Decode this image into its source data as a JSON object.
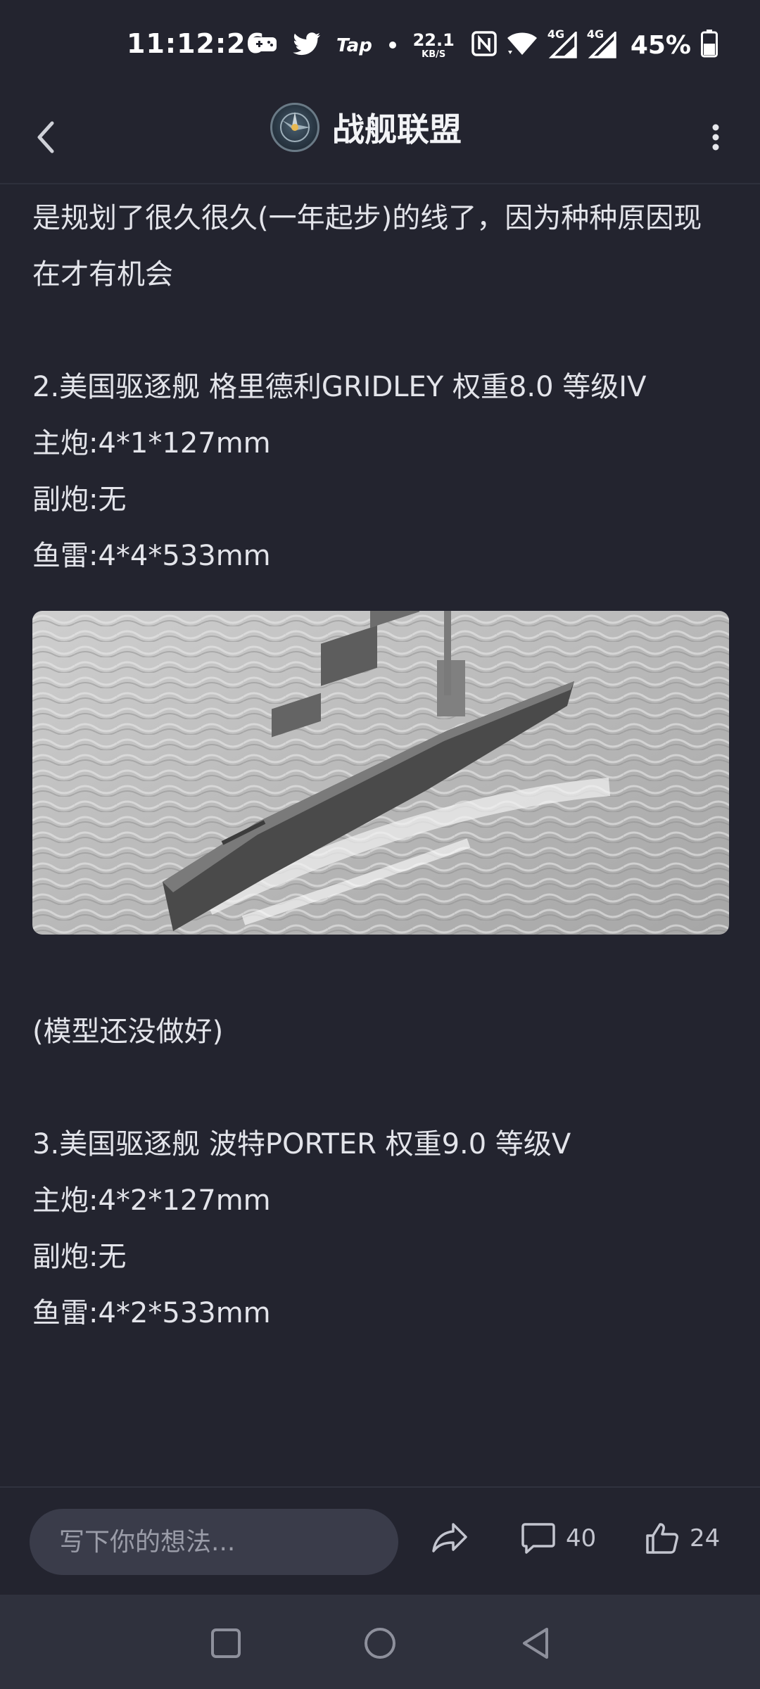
{
  "status_bar": {
    "time": "11:12:26",
    "tap_label": "Tap",
    "net_speed_value": "22.1",
    "net_speed_unit": "KB/S",
    "network_1": "4G",
    "network_2": "4G",
    "battery": "45%"
  },
  "header": {
    "title": "战舰联盟"
  },
  "post": {
    "intro_line": "是规划了很久很久(一年起步)的线了，因为种种原因现在才有机会",
    "ship2_title": "2.美国驱逐舰 格里德利GRIDLEY 权重8.0 等级IV",
    "ship2_main": "主炮:4*1*127mm",
    "ship2_secondary": "副炮:无",
    "ship2_torpedo": "鱼雷:4*4*533mm",
    "model_note": "(模型还没做好)",
    "ship3_title": "3.美国驱逐舰 波特PORTER 权重9.0 等级V",
    "ship3_main": "主炮:4*2*127mm",
    "ship3_secondary": "副炮:无",
    "ship3_torpedo": "鱼雷:4*2*533mm"
  },
  "action_bar": {
    "comment_placeholder": "写下你的想法...",
    "comment_count": "40",
    "like_count": "24"
  }
}
